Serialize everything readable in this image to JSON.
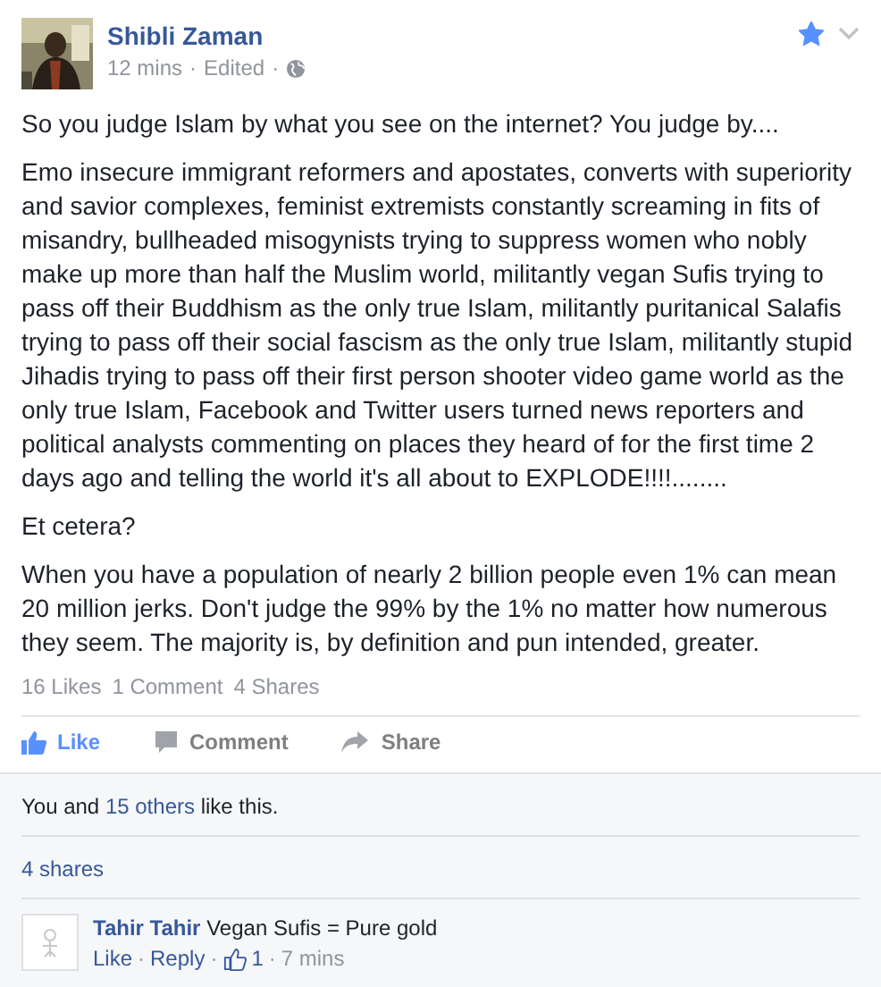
{
  "post": {
    "author": "Shibli Zaman",
    "time": "12 mins",
    "edited": "Edited",
    "separator": "·",
    "starred": true,
    "paragraphs": [
      "So you judge Islam by what you see on the internet? You judge by....",
      "Emo insecure immigrant reformers and apostates, converts with superiority and savior complexes, feminist extremists constantly screaming in fits of misandry, bullheaded misogynists trying to suppress women who nobly make up more than half the Muslim world, militantly vegan Sufis trying to pass off their Buddhism as the only true Islam, militantly puritanical Salafis trying to pass off their social fascism as the only true Islam, militantly stupid Jihadis trying to pass off their first person shooter video game world as the only true Islam, Facebook and Twitter users turned news reporters and political analysts commenting on places they heard of for the first time 2 days ago and telling the world it's all about to EXPLODE!!!!........",
      "Et cetera?",
      "When you have a population of nearly 2 billion people even 1% can mean 20 million jerks. Don't judge the 99% by the 1% no matter how numerous they seem. The majority is, by definition and pun intended, greater."
    ],
    "stats": [
      "16 Likes",
      "1 Comment",
      "4 Shares"
    ],
    "actions": [
      {
        "kind": "like",
        "label": "Like",
        "selected": true
      },
      {
        "kind": "comment",
        "label": "Comment",
        "selected": false
      },
      {
        "kind": "share",
        "label": "Share",
        "selected": false
      }
    ]
  },
  "likes_summary": {
    "prefix": "You and",
    "link": "15 others",
    "suffix": "like this."
  },
  "shares_link": "4 shares",
  "comments": [
    {
      "author": "Tahir Tahir",
      "text": "Vegan Sufis = Pure gold",
      "like": "Like",
      "reply": "Reply",
      "likes": "1",
      "time": "7 mins",
      "separator": "·"
    }
  ]
}
